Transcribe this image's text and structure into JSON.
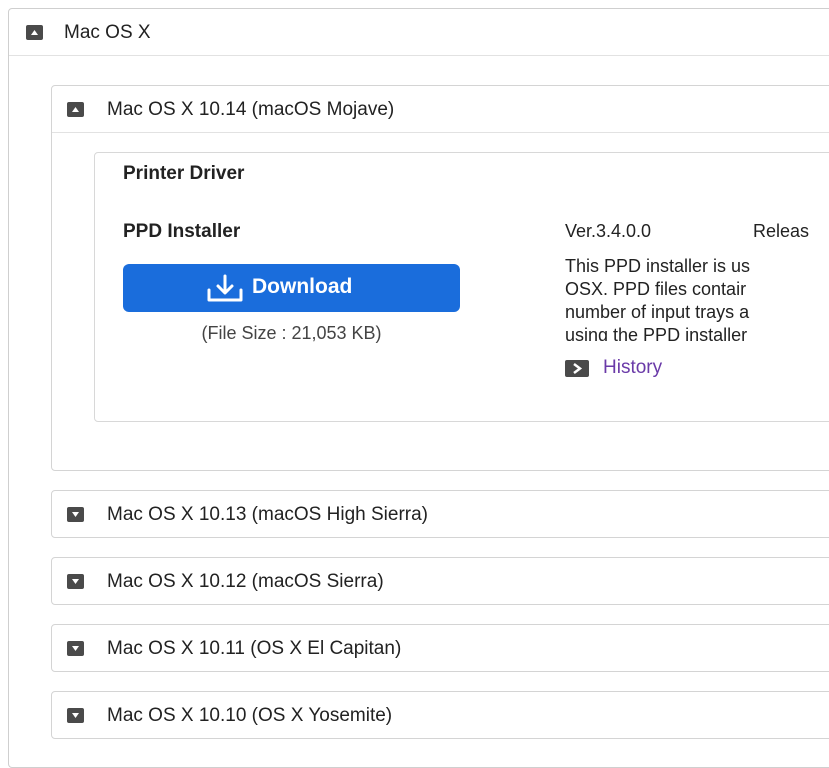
{
  "outer_panel": {
    "title": "Mac OS X"
  },
  "mojave_panel": {
    "title": "Mac OS X 10.14 (macOS Mojave)",
    "section_title": "Printer Driver",
    "item_name": "PPD Installer",
    "download_label": "Download",
    "file_size": "(File Size : 21,053 KB)",
    "version": "Ver.3.4.0.0",
    "release_label": "Releas",
    "description_lines": [
      "This PPD installer is us",
      "OSX. PPD files contair",
      "number of input trays a",
      "using the PPD installer"
    ],
    "history_label": "History"
  },
  "collapsed_panels": [
    {
      "title": "Mac OS X 10.13 (macOS High Sierra)"
    },
    {
      "title": "Mac OS X 10.12 (macOS Sierra)"
    },
    {
      "title": "Mac OS X 10.11 (OS X El Capitan)"
    },
    {
      "title": "Mac OS X 10.10 (OS X Yosemite)"
    }
  ],
  "icons": {
    "expanded": "caret-up-icon",
    "collapsed": "caret-down-icon",
    "download": "download-icon",
    "history": "chevron-right-icon"
  },
  "colors": {
    "download_button": "#1a6ddc",
    "history_link": "#6a3aa8",
    "icon_bg": "#4a4a4a"
  }
}
